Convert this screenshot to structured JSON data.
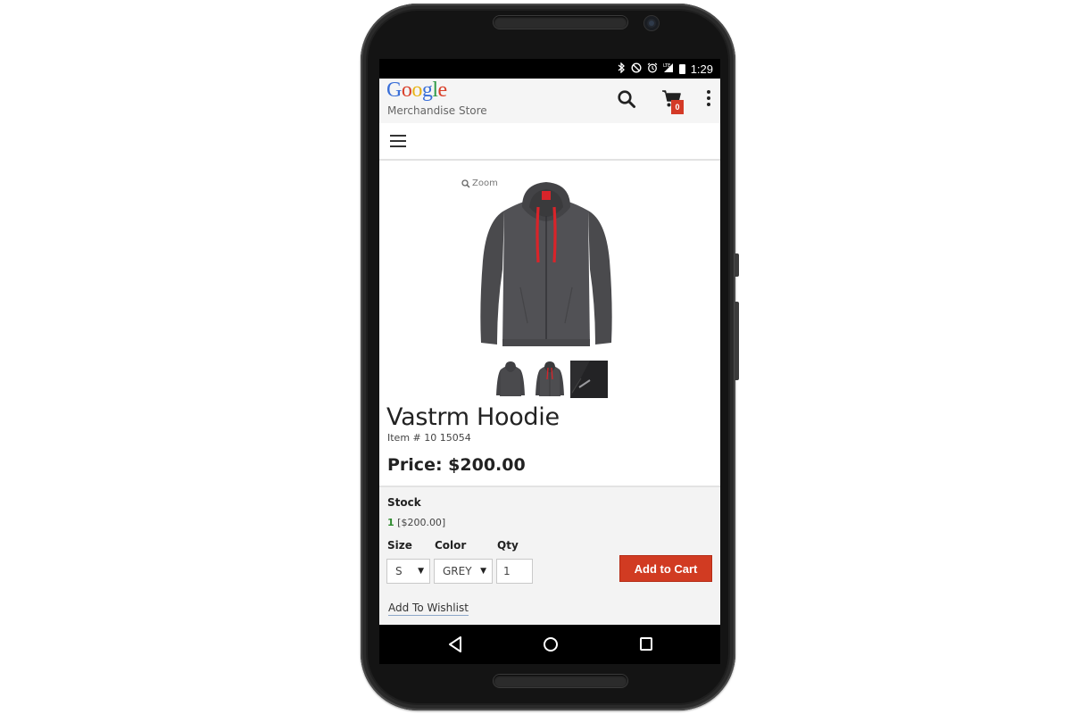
{
  "status_bar": {
    "time": "1:29",
    "icons": [
      "bluetooth-icon",
      "do-not-disturb-icon",
      "alarm-icon",
      "lte-signal-icon",
      "battery-icon"
    ]
  },
  "store": {
    "logo_letters": [
      "G",
      "o",
      "o",
      "g",
      "l",
      "e"
    ],
    "subtitle": "Merchandise Store",
    "cart_count": "0"
  },
  "product": {
    "zoom_label": "Zoom",
    "title": "Vastrm Hoodie",
    "item_number": "Item # 10 15054",
    "price": "Price: $200.00"
  },
  "buy_box": {
    "stock_label": "Stock",
    "stock_qty": "1",
    "stock_price": "[$200.00]",
    "size_label": "Size",
    "size_value": "S",
    "color_label": "Color",
    "color_value": "GREY",
    "qty_label": "Qty",
    "qty_value": "1",
    "add_to_cart": "Add to Cart",
    "wishlist": "Add To Wishlist"
  },
  "colors": {
    "accent_red": "#d13b22",
    "stock_green": "#2e8b2e",
    "hoodie_grey": "#4a4a4d",
    "drawstring_red": "#d8242a"
  }
}
